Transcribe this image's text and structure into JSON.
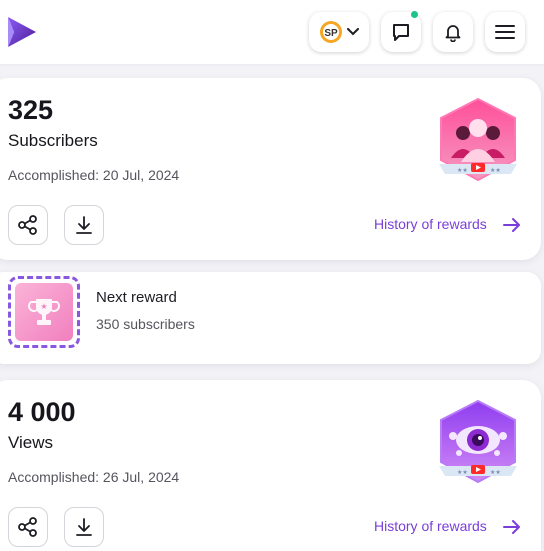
{
  "header": {
    "profile_initials": "SP",
    "colors": {
      "brand": "#6b3fd8",
      "notification_dot": "#1ec28b"
    },
    "icons": [
      "logo-icon",
      "chevron-down-icon",
      "chat-icon",
      "bell-icon",
      "menu-icon"
    ]
  },
  "cards": [
    {
      "count": "325",
      "metric": "Subscribers",
      "accomplished": "Accomplished: 20 Jul, 2024",
      "history_label": "History of rewards"
    },
    {
      "count": "4 000",
      "metric": "Views",
      "accomplished": "Accomplished: 26 Jul, 2024",
      "history_label": "History of rewards"
    }
  ],
  "next_reward": {
    "title": "Next reward",
    "subtitle": "350 subscribers"
  },
  "colors": {
    "accent": "#7a3fd8",
    "badge_pink": "#f2679b",
    "badge_purple": "#a349e6"
  }
}
